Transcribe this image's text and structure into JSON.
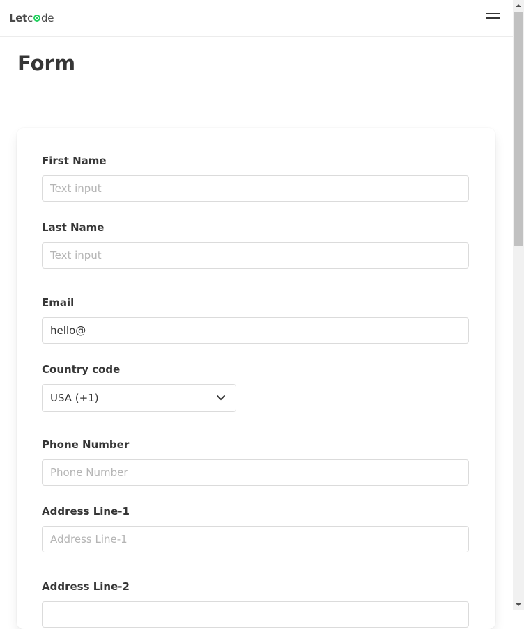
{
  "brand": {
    "part1": "Let",
    "part2": "c",
    "part3": "de"
  },
  "page": {
    "title": "Form"
  },
  "form": {
    "first_name": {
      "label": "First Name",
      "placeholder": "Text input",
      "value": ""
    },
    "last_name": {
      "label": "Last Name",
      "placeholder": "Text input",
      "value": ""
    },
    "email": {
      "label": "Email",
      "placeholder": "",
      "value": "hello@"
    },
    "country_code": {
      "label": "Country code",
      "selected": "USA (+1)"
    },
    "phone": {
      "label": "Phone Number",
      "placeholder": "Phone Number",
      "value": ""
    },
    "address1": {
      "label": "Address Line-1",
      "placeholder": "Address Line-1",
      "value": ""
    },
    "address2": {
      "label": "Address Line-2",
      "placeholder": "",
      "value": ""
    }
  },
  "icons": {
    "menu": "hamburger-icon",
    "select": "chevron-down-icon"
  },
  "colors": {
    "logo_accent": "#23d160",
    "text": "#363636",
    "border": "#dbdbdb",
    "placeholder": "#b5b5b5"
  }
}
